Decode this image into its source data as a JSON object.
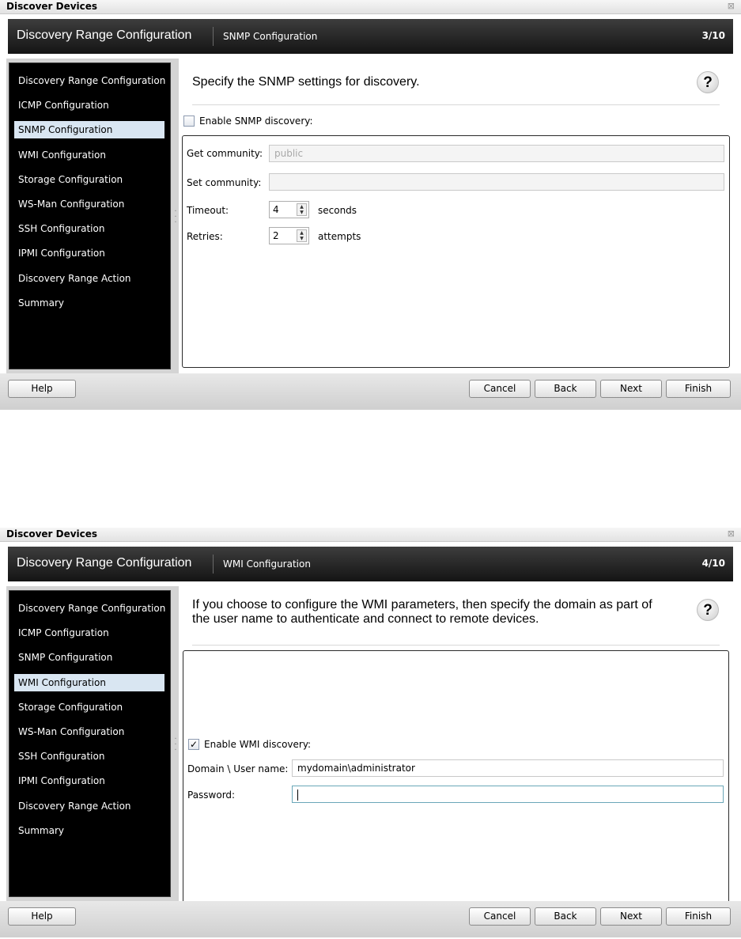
{
  "dialogs": [
    {
      "window_title": "Discover Devices",
      "close_glyph": "⊠",
      "header_title": "Discovery Range Configuration",
      "header_subtitle": "SNMP Configuration",
      "step": "3/10",
      "nav_items": [
        "Discovery Range Configuration",
        "ICMP Configuration",
        "SNMP Configuration",
        "WMI Configuration",
        "Storage Configuration",
        "WS-Man Configuration",
        "SSH Configuration",
        "IPMI Configuration",
        "Discovery Range Action",
        "Summary"
      ],
      "active_nav": "SNMP Configuration",
      "intro": "Specify the SNMP settings for discovery.",
      "help_glyph": "?",
      "enable_label": "Enable SNMP discovery:",
      "enable_checked": false,
      "get_community_label": "Get community:",
      "get_community_value": "public",
      "set_community_label": "Set community:",
      "set_community_value": "",
      "timeout_label": "Timeout:",
      "timeout_value": "4",
      "timeout_unit": "seconds",
      "retries_label": "Retries:",
      "retries_value": "2",
      "retries_unit": "attempts",
      "buttons": {
        "help": "Help",
        "cancel": "Cancel",
        "back": "Back",
        "next": "Next",
        "finish": "Finish"
      }
    },
    {
      "window_title": "Discover Devices",
      "close_glyph": "⊠",
      "header_title": "Discovery Range Configuration",
      "header_subtitle": "WMI Configuration",
      "step": "4/10",
      "nav_items": [
        "Discovery Range Configuration",
        "ICMP Configuration",
        "SNMP Configuration",
        "WMI Configuration",
        "Storage Configuration",
        "WS-Man Configuration",
        "SSH Configuration",
        "IPMI Configuration",
        "Discovery Range Action",
        "Summary"
      ],
      "active_nav": "WMI Configuration",
      "intro": "If you choose to configure the WMI parameters, then specify the domain as part of the user name to authenticate and connect to remote devices.",
      "help_glyph": "?",
      "enable_label": "Enable WMI discovery:",
      "enable_checked": true,
      "check_glyph": "✓",
      "username_label": "Domain \\ User name:",
      "username_value": "mydomain\\administrator",
      "password_label": "Password:",
      "password_value": "",
      "buttons": {
        "help": "Help",
        "cancel": "Cancel",
        "back": "Back",
        "next": "Next",
        "finish": "Finish"
      }
    }
  ],
  "icons": {
    "close": "close-icon",
    "help": "help-icon",
    "checkbox": "checkbox-icon",
    "spinner": "spinner-arrows-icon"
  },
  "colors": {
    "header_bg": "#1f1f1f",
    "sidebar_bg": "#000000",
    "nav_active_bg": "#d9e6f2",
    "focus_border": "#6aa7b8"
  }
}
